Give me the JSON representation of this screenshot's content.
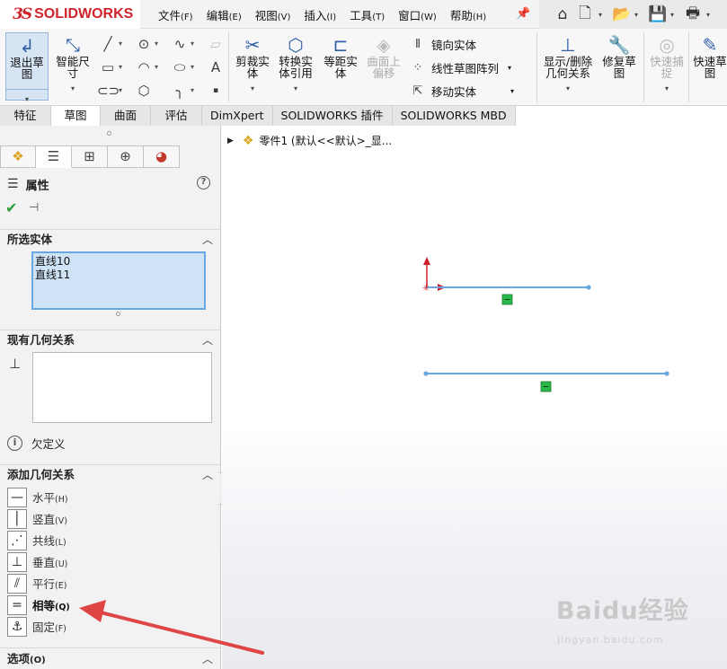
{
  "app": {
    "logo_ds": "3S",
    "logo_text": "SOLIDWORKS"
  },
  "menu": [
    {
      "label": "文件",
      "key": "(F)"
    },
    {
      "label": "编辑",
      "key": "(E)"
    },
    {
      "label": "视图",
      "key": "(V)"
    },
    {
      "label": "插入",
      "key": "(I)"
    },
    {
      "label": "工具",
      "key": "(T)"
    },
    {
      "label": "窗口",
      "key": "(W)"
    },
    {
      "label": "帮助",
      "key": "(H)"
    }
  ],
  "ribbon": {
    "exit_sketch": "退出草图",
    "smart_dimension": "智能尺寸",
    "trim_entities": "剪裁实体",
    "convert_entities": "转换实体引用",
    "offset_entities": "等距实体",
    "offset_on_surface": "曲面上偏移",
    "mirror_entities": "镜向实体",
    "linear_pattern": "线性草图阵列",
    "move_entities": "移动实体",
    "display_relations": "显示/删除几何关系",
    "repair_sketch": "修复草图",
    "quick_snaps": "快速捕捉",
    "rapid_sketch": "快速草图"
  },
  "cm_tabs": [
    "特征",
    "草图",
    "曲面",
    "评估",
    "DimXpert",
    "SOLIDWORKS 插件",
    "SOLIDWORKS MBD"
  ],
  "panel": {
    "title": "属性",
    "help": "?",
    "selected_entities": {
      "title": "所选实体",
      "items": [
        "直线10",
        "直线11"
      ]
    },
    "existing_relations": {
      "title": "现有几何关系",
      "status": "欠定义"
    },
    "add_relations": {
      "title": "添加几何关系",
      "items": [
        {
          "label": "水平",
          "key": "(H)"
        },
        {
          "label": "竖直",
          "key": "(V)"
        },
        {
          "label": "共线",
          "key": "(L)"
        },
        {
          "label": "垂直",
          "key": "(U)"
        },
        {
          "label": "平行",
          "key": "(E)"
        },
        {
          "label": "相等",
          "key": "(Q)"
        },
        {
          "label": "固定",
          "key": "(F)"
        }
      ]
    },
    "options_title": "选项",
    "options_key": "(O)"
  },
  "tree": {
    "part_label": "零件1  (默认<<默认>_显..."
  },
  "watermark": {
    "main": "Baidu经验",
    "sub": "jingyan.baidu.com"
  },
  "colors": {
    "accent": "#2f5fa8",
    "sketch_line": "#6aa7e0",
    "relation_marker": "#29b84a",
    "arrow": "#e04545",
    "origin": "#cc1f2a"
  }
}
